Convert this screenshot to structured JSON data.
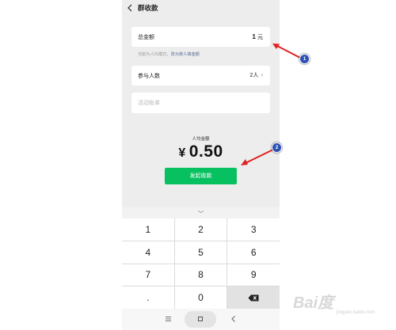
{
  "header": {
    "title": "群收款"
  },
  "total": {
    "label": "总金额",
    "amount": "1",
    "unit": "元"
  },
  "hint": {
    "text": "当前为人均模式，",
    "link": "改为按人填金额"
  },
  "people": {
    "label": "参与人数",
    "value": "2人",
    "chevron": "›"
  },
  "note": {
    "placeholder": "活动账单"
  },
  "average": {
    "label": "人均金额",
    "currency": "¥",
    "value": "0.50"
  },
  "start_button": {
    "label": "发起收款"
  },
  "keypad": {
    "keys": [
      "1",
      "2",
      "3",
      "4",
      "5",
      "6",
      "7",
      "8",
      "9",
      ".",
      "0",
      ""
    ]
  },
  "annotations": [
    {
      "number": "1"
    },
    {
      "number": "2"
    }
  ],
  "watermark": {
    "text": "Bai度",
    "sub": "jingyan.baidu.com"
  },
  "colors": {
    "accent": "#07c160",
    "link": "#576b95",
    "annotation_arrow": "#e02020",
    "badge": "#2a4fb5"
  }
}
